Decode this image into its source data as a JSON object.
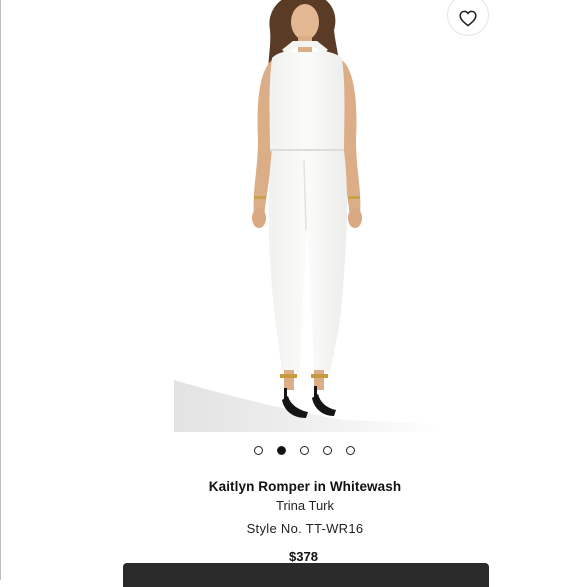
{
  "product": {
    "title": "Kaitlyn Romper in Whitewash",
    "brand": "Trina Turk",
    "style_number": "Style No. TT-WR16",
    "price": "$378"
  },
  "image": {
    "description_icon": "product-photo",
    "carousel_total": 5,
    "carousel_active_index": 1
  },
  "favorite": {
    "icon": "heart-icon"
  },
  "colors": {
    "background": "#ffffff",
    "text": "#111111",
    "bottom_bar": "#2b2b2b"
  }
}
